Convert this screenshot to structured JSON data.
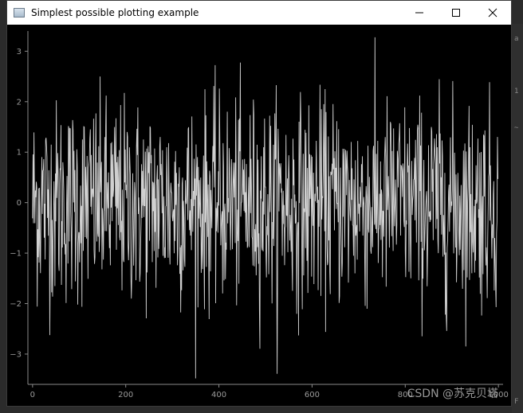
{
  "window": {
    "title": "Simplest possible plotting example",
    "icon": "app-window-icon",
    "controls": [
      "minimize-icon",
      "maximize-icon",
      "close-icon"
    ]
  },
  "watermark": "CSDN @苏克贝塔",
  "side_strip_glyphs": [
    "a",
    "1",
    "~",
    "F"
  ],
  "chart_data": {
    "type": "line",
    "title": "",
    "xlabel": "",
    "ylabel": "",
    "xlim": [
      -10,
      1010
    ],
    "ylim": [
      -3.6,
      3.4
    ],
    "x_ticks": [
      0,
      200,
      400,
      600,
      800,
      1000
    ],
    "x_tick_labels": [
      "0",
      "200",
      "400",
      "600",
      "800",
      "1000"
    ],
    "y_ticks": [
      -3,
      -2,
      -1,
      0,
      1,
      2,
      3
    ],
    "y_tick_labels": [
      "−3",
      "−2",
      "−1",
      "0",
      "1",
      "2",
      "3"
    ],
    "grid": false,
    "line_color": "#d0d0d0",
    "background": "#000000",
    "series": [
      {
        "n_points": 1000,
        "distribution": "standard normal random noise",
        "min": -3.5,
        "max": 3.3
      }
    ]
  }
}
